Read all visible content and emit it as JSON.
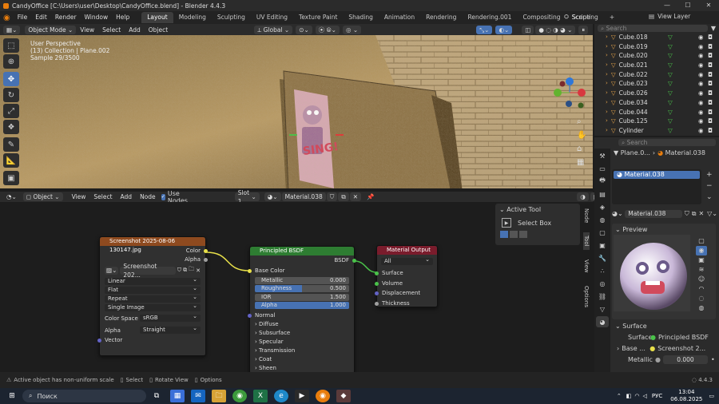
{
  "window": {
    "title": "CandyOffice [C:\\Users\\user\\Desktop\\CandyOffice.blend] - Blender 4.4.3",
    "minimize": "—",
    "maximize": "☐",
    "close": "✕"
  },
  "menubar": {
    "items": [
      "File",
      "Edit",
      "Render",
      "Window",
      "Help"
    ],
    "tabs": [
      "Layout",
      "Modeling",
      "Sculpting",
      "UV Editing",
      "Texture Paint",
      "Shading",
      "Animation",
      "Rendering",
      "Rendering.001",
      "Compositing",
      "Scripting"
    ],
    "add_tab": "+",
    "scene_label": "Scene",
    "view_layer_label": "View Layer"
  },
  "viewport": {
    "mode": "Object Mode",
    "menus": [
      "View",
      "Select",
      "Add",
      "Object"
    ],
    "transform": "Global",
    "info": [
      "User Perspective",
      "(13) Collection | Plane.002",
      "Sample 29/3500"
    ],
    "poster_text": "SING!"
  },
  "node_editor": {
    "type": "Object",
    "menus": [
      "View",
      "Select",
      "Add",
      "Node"
    ],
    "use_nodes": "Use Nodes",
    "slot": "Slot 1",
    "material": "Material.038",
    "side_tabs": [
      "Node",
      "Tool",
      "View",
      "Options"
    ],
    "active_tool": {
      "title": "Active Tool",
      "tool": "Select Box"
    },
    "image_node": {
      "title": "Screenshot 2025-08-06 130147.jpg",
      "out_color": "Color",
      "out_alpha": "Alpha",
      "image_name": "Screenshot 202...",
      "interpolation": "Linear",
      "projection": "Flat",
      "extension": "Repeat",
      "source": "Single Image",
      "color_space_label": "Color Space",
      "color_space": "sRGB",
      "alpha_label": "Alpha",
      "alpha": "Straight",
      "vector": "Vector"
    },
    "bsdf_node": {
      "title": "Principled BSDF",
      "out": "BSDF",
      "base_color": "Base Color",
      "fields": [
        {
          "label": "Metallic",
          "value": "0.000",
          "fill": 0
        },
        {
          "label": "Roughness",
          "value": "0.500",
          "fill": 0.5
        },
        {
          "label": "IOR",
          "value": "1.500",
          "fill": 0
        },
        {
          "label": "Alpha",
          "value": "1.000",
          "fill": 1
        }
      ],
      "normal": "Normal",
      "sections": [
        "Diffuse",
        "Subsurface",
        "Specular",
        "Transmission",
        "Coat",
        "Sheen"
      ]
    },
    "output_node": {
      "title": "Material Output",
      "target": "All",
      "inputs": [
        "Surface",
        "Volume",
        "Displacement",
        "Thickness"
      ]
    }
  },
  "outliner": {
    "search_placeholder": "Search",
    "items": [
      "Cube.018",
      "Cube.019",
      "Cube.020",
      "Cube.021",
      "Cube.022",
      "Cube.023",
      "Cube.026",
      "Cube.034",
      "Cube.044",
      "Cube.125",
      "Cylinder"
    ]
  },
  "properties": {
    "search_placeholder": "Search",
    "breadcrumb": [
      "Plane.0...",
      "Material.038"
    ],
    "slot_item": "Material.038",
    "material_name": "Material.038",
    "preview_label": "Preview",
    "surface_section": "Surface",
    "surface_label": "Surface",
    "surface_value": "Principled BSDF",
    "base_label": "Base ...",
    "base_value": "Screenshot 2...",
    "metallic_label": "Metallic",
    "metallic_value": "0.000"
  },
  "status": {
    "warning": "Active object has non-uniform scale",
    "select": "Select",
    "rotate": "Rotate View",
    "options": "Options",
    "version": "4.4.3"
  },
  "taskbar": {
    "search": "Поиск",
    "lang": "РУС",
    "time": "13:04",
    "date": "06.08.2025"
  },
  "colors": {
    "accent": "#4772b3",
    "orange": "#e87d0d",
    "image_header": "#8e4a1f",
    "shader_header": "#2e7d32",
    "output_header": "#7a1c2c"
  }
}
